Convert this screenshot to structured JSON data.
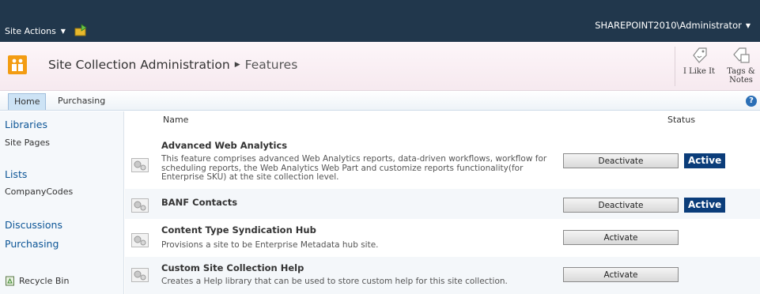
{
  "topbar": {
    "site_actions": "Site Actions",
    "user": "SHAREPOINT2010\\Administrator"
  },
  "title": {
    "crumb_parent": "Site Collection Administration",
    "crumb_current": "Features",
    "like_label": "I Like It",
    "tags_label_1": "Tags &",
    "tags_label_2": "Notes"
  },
  "topnav": {
    "tabs": [
      "Home",
      "Purchasing"
    ]
  },
  "quicklaunch": {
    "libraries": "Libraries",
    "site_pages": "Site Pages",
    "lists": "Lists",
    "company_codes": "CompanyCodes",
    "discussions": "Discussions",
    "purchasing": "Purchasing",
    "recycle_bin": "Recycle Bin"
  },
  "table": {
    "col_name": "Name",
    "col_status": "Status",
    "features": [
      {
        "name": "Advanced Web Analytics",
        "desc": "This feature comprises advanced Web Analytics reports, data-driven workflows, workflow for scheduling reports, the Web Analytics Web Part and customize reports functionality(for Enterprise SKU) at the site collection level.",
        "button": "Deactivate",
        "status": "Active"
      },
      {
        "name": "BANF Contacts",
        "desc": "",
        "button": "Deactivate",
        "status": "Active"
      },
      {
        "name": "Content Type Syndication Hub",
        "desc": "Provisions a site to be Enterprise Metadata hub site.",
        "button": "Activate",
        "status": ""
      },
      {
        "name": "Custom Site Collection Help",
        "desc": "Creates a Help library that can be used to store custom help for this site collection.",
        "button": "Activate",
        "status": ""
      }
    ]
  }
}
